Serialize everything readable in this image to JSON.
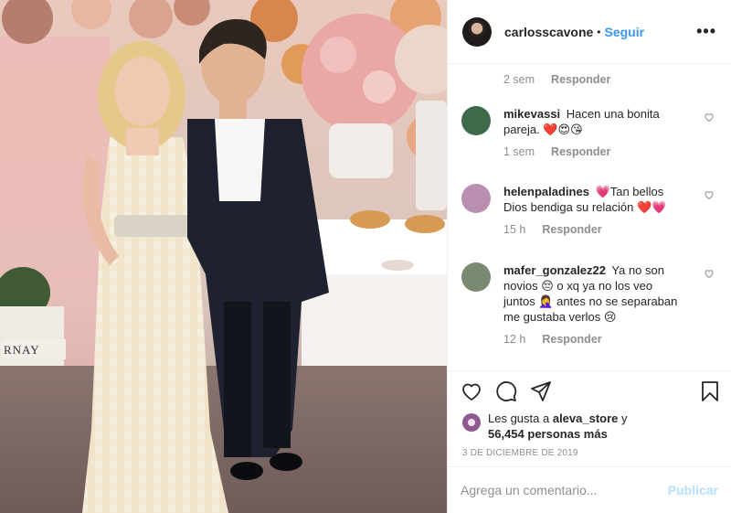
{
  "header": {
    "username": "carlosscavone",
    "separator": "•",
    "follow_label": "Seguir",
    "more_label": "•••"
  },
  "photo": {
    "sign_text": "RNAY"
  },
  "comments": {
    "first_meta": {
      "time": "2 sem",
      "reply": "Responder"
    },
    "items": [
      {
        "user": "mikevassi",
        "text": "Hacen una bonita pareja. ❤️😍😘",
        "time": "1 sem",
        "reply": "Responder",
        "avatar_color": "#3f6a4a"
      },
      {
        "user": "helenpaladines",
        "text": "💗Tan bellos Dios bendiga su relación ❤️💗",
        "time": "15 h",
        "reply": "Responder",
        "avatar_color": "#b88fb0"
      },
      {
        "user": "mafer_gonzalez22",
        "text": "Ya no son novios 😔 o xq ya no los veo juntos 🤦‍♀️ antes no se separaban me gustaba verlos 😢",
        "time": "12 h",
        "reply": "Responder",
        "avatar_color": "#7a8a70"
      }
    ]
  },
  "likes": {
    "prefix": "Les gusta a",
    "user": "aleva_store",
    "conj": "y",
    "count": "56,454 personas más"
  },
  "date": "3 DE DICIEMBRE DE 2019",
  "add_comment": {
    "placeholder": "Agrega un comentario...",
    "publish_label": "Publicar"
  },
  "icons": {
    "like": "heart-icon",
    "comment": "comment-icon",
    "share": "share-icon",
    "save": "bookmark-icon"
  }
}
